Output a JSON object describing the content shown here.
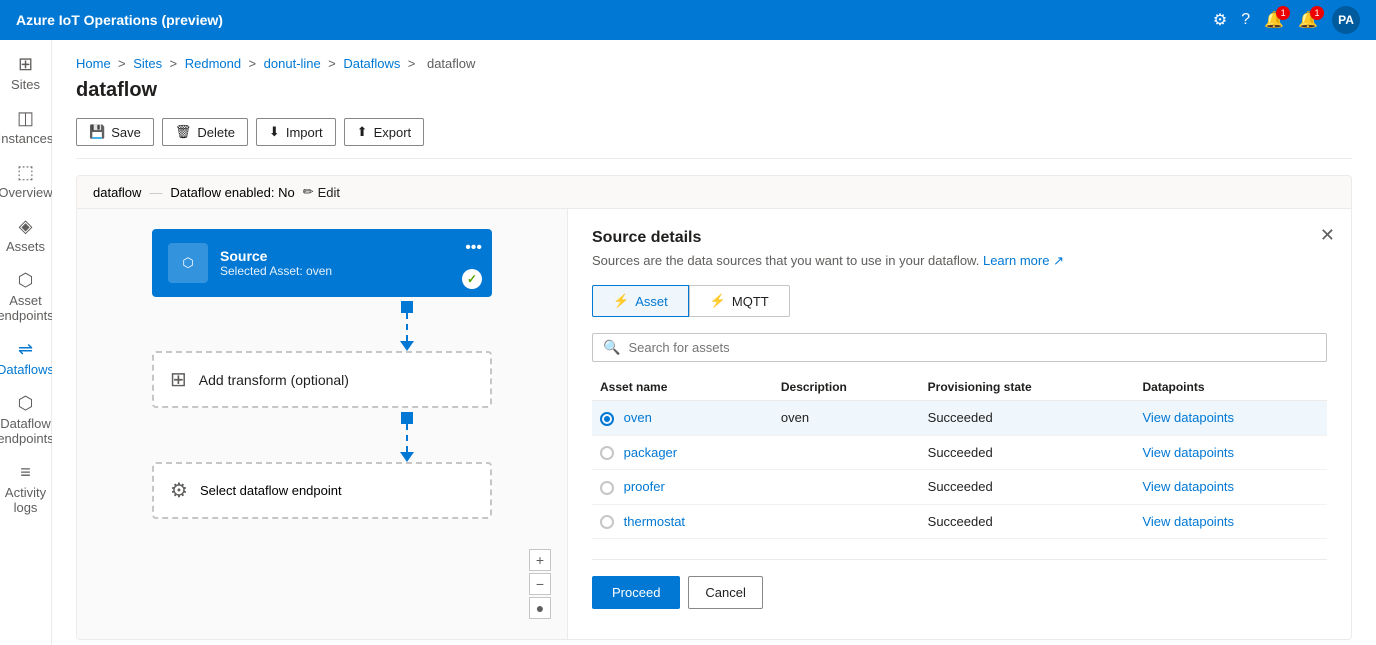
{
  "app": {
    "title": "Azure IoT Operations (preview)"
  },
  "topbar": {
    "title": "Azure IoT Operations (preview)",
    "avatar_initials": "PA"
  },
  "sidebar": {
    "items": [
      {
        "id": "sites",
        "label": "Sites",
        "icon": "⊞"
      },
      {
        "id": "instances",
        "label": "Instances",
        "icon": "◫"
      },
      {
        "id": "overview",
        "label": "Overview",
        "icon": "⊡"
      },
      {
        "id": "assets",
        "label": "Assets",
        "icon": "◈"
      },
      {
        "id": "asset-endpoints",
        "label": "Asset endpoints",
        "icon": "⬡"
      },
      {
        "id": "dataflows",
        "label": "Dataflows",
        "icon": "⇌"
      },
      {
        "id": "dataflow-endpoints",
        "label": "Dataflow endpoints",
        "icon": "⬡"
      },
      {
        "id": "activity-logs",
        "label": "Activity logs",
        "icon": "≡"
      }
    ]
  },
  "breadcrumb": {
    "items": [
      "Home",
      "Sites",
      "Redmond",
      "donut-line",
      "Dataflows",
      "dataflow"
    ]
  },
  "page": {
    "title": "dataflow"
  },
  "toolbar": {
    "save": "Save",
    "delete": "Delete",
    "import": "Import",
    "export": "Export"
  },
  "dataflow_header": {
    "name": "dataflow",
    "status": "Dataflow enabled: No",
    "edit": "Edit"
  },
  "canvas": {
    "source_card": {
      "title": "Source",
      "subtitle": "Selected Asset: oven"
    },
    "transform_card": {
      "label": "Add transform (optional)"
    },
    "endpoint_card": {
      "label": "Select dataflow endpoint"
    }
  },
  "panel": {
    "title": "Source details",
    "subtitle": "Sources are the data sources that you want to use in your dataflow.",
    "learn_more": "Learn more",
    "close_icon": "✕",
    "tabs": [
      {
        "id": "asset",
        "label": "Asset",
        "icon": "⚡",
        "active": true
      },
      {
        "id": "mqtt",
        "label": "MQTT",
        "icon": "⚡",
        "active": false
      }
    ],
    "search_placeholder": "Search for assets",
    "table": {
      "headers": [
        "Asset name",
        "Description",
        "Provisioning state",
        "Datapoints"
      ],
      "rows": [
        {
          "name": "oven",
          "description": "oven",
          "state": "Succeeded",
          "dp_link": "View datapoints",
          "selected": true
        },
        {
          "name": "packager",
          "description": "",
          "state": "Succeeded",
          "dp_link": "View datapoints",
          "selected": false
        },
        {
          "name": "proofer",
          "description": "",
          "state": "Succeeded",
          "dp_link": "View datapoints",
          "selected": false
        },
        {
          "name": "thermostat",
          "description": "",
          "state": "Succeeded",
          "dp_link": "View datapoints",
          "selected": false
        }
      ]
    },
    "proceed_label": "Proceed",
    "cancel_label": "Cancel"
  }
}
